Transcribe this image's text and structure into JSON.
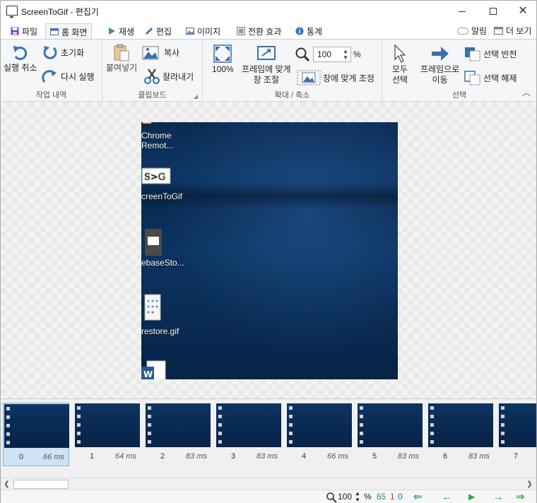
{
  "window": {
    "title": "ScreenToGif - 편집기"
  },
  "tabs": [
    {
      "label": "파일",
      "icon": "save-icon"
    },
    {
      "label": "홈 화면",
      "icon": "home-window-icon"
    },
    {
      "label": "재생",
      "icon": "play-icon"
    },
    {
      "label": "편집",
      "icon": "pencil-icon"
    },
    {
      "label": "이미지",
      "icon": "image-icon"
    },
    {
      "label": "전환 효과",
      "icon": "transition-icon"
    },
    {
      "label": "통계",
      "icon": "info-icon"
    }
  ],
  "tabbar_right": {
    "notifications": "알림",
    "more": "더 보기"
  },
  "ribbon": {
    "action_history": {
      "label": "작업 내역",
      "undo": "실행 취소",
      "reset": "초기화",
      "redo": "다시 실행"
    },
    "clipboard": {
      "label": "클립보드",
      "paste": "붙여넣기",
      "copy": "복사",
      "cut": "잘라내기"
    },
    "zoom": {
      "label": "확대 / 축소",
      "zoom100": "100%",
      "fit_frame_line1": "프레임에 맞게",
      "fit_frame_line2": "창 조절",
      "zoom_value": "100",
      "zoom_unit": "%",
      "fit_window": "창에 맞게 조정"
    },
    "selection": {
      "label": "선택",
      "select_all_line1": "모두",
      "select_all_line2": "선택",
      "goto_frame_line1": "프레임으로",
      "goto_frame_line2": "이동",
      "invert": "선택 반전",
      "deselect": "선택 해제"
    }
  },
  "desktop_icons": [
    {
      "line1": "Chrome",
      "line2": "Remot..."
    },
    {
      "line1": "creenToGif",
      "line2": ""
    },
    {
      "line1": "ebaseSto...",
      "line2": ""
    },
    {
      "line1": "restore.gif",
      "line2": ""
    }
  ],
  "frames": [
    {
      "num": "0",
      "ms": "66 ms"
    },
    {
      "num": "1",
      "ms": "64 ms"
    },
    {
      "num": "2",
      "ms": "83 ms"
    },
    {
      "num": "3",
      "ms": "83 ms"
    },
    {
      "num": "4",
      "ms": "66 ms"
    },
    {
      "num": "5",
      "ms": "83 ms"
    },
    {
      "num": "6",
      "ms": "83 ms"
    },
    {
      "num": "7",
      "ms": ""
    }
  ],
  "status": {
    "zoom": "100",
    "zoom_unit": "%",
    "total_frames": "65",
    "selected_count": "1",
    "current_index": "0",
    "colors": {
      "total": "#3a9a3a",
      "selected": "#d03030",
      "index": "#2a6fc0"
    }
  }
}
